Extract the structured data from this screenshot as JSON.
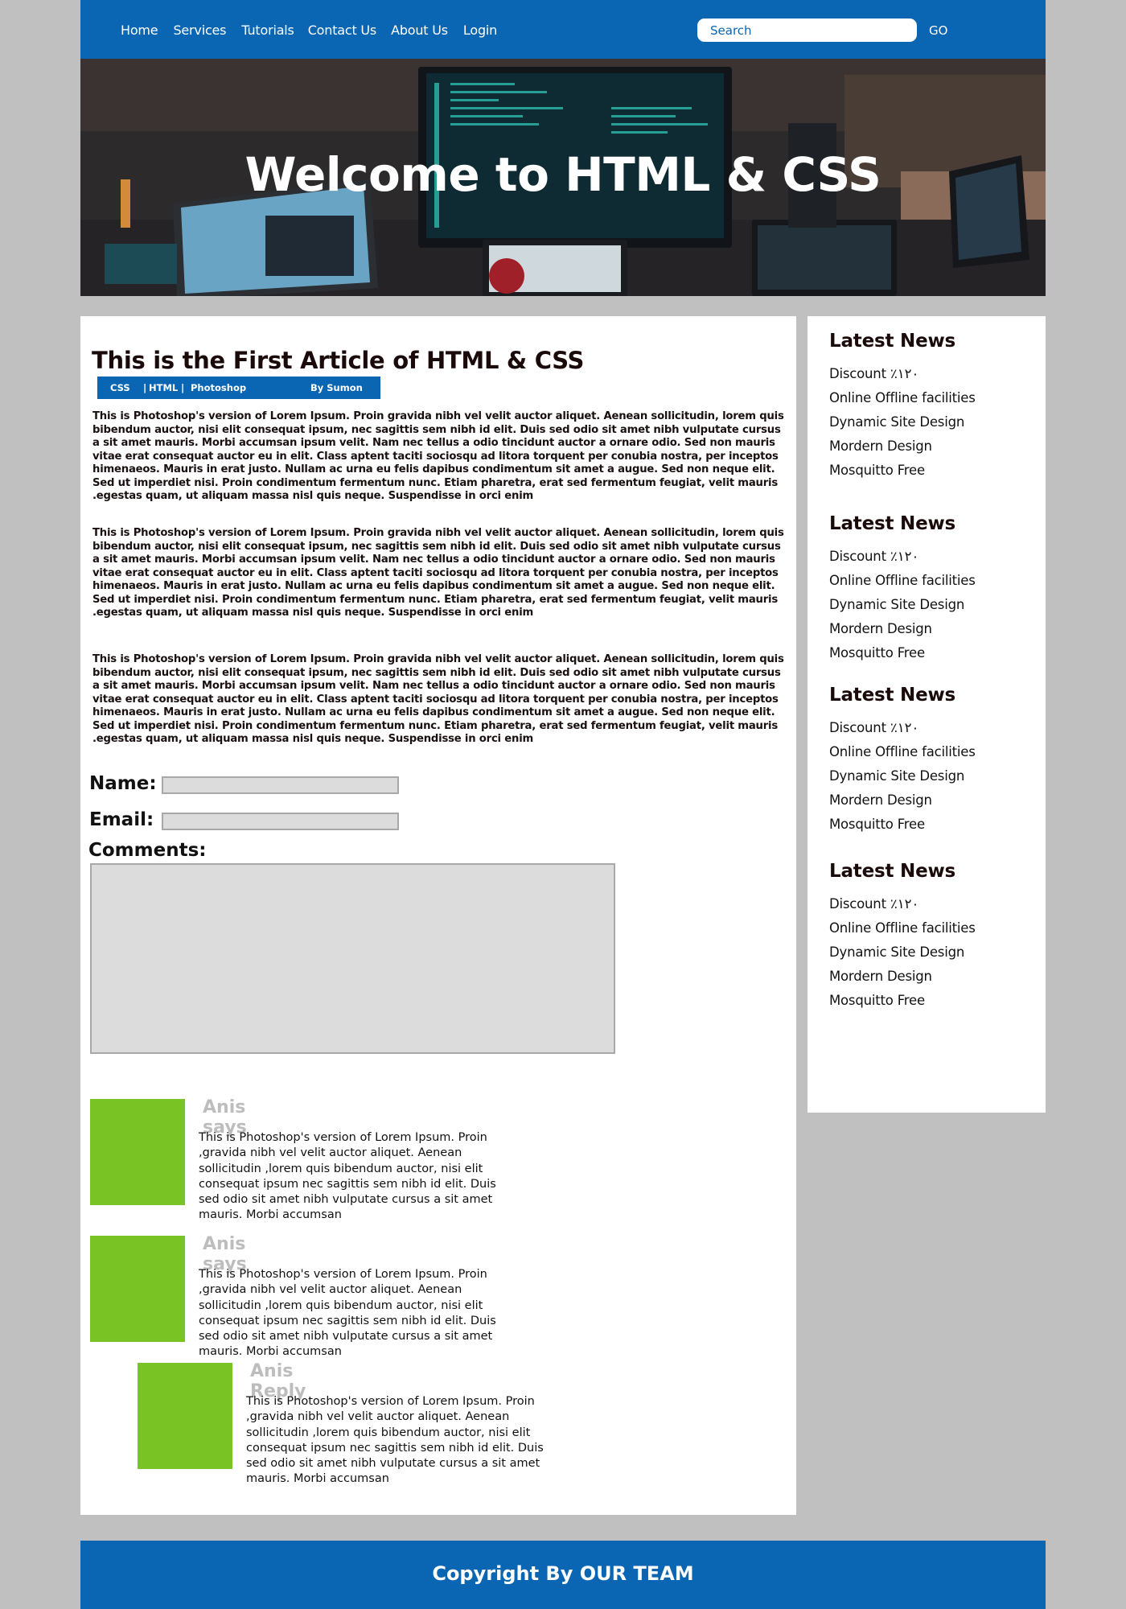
{
  "nav": {
    "links": [
      "Home",
      "Services",
      "Tutorials",
      "Contact Us",
      "About Us",
      "Login"
    ],
    "search_placeholder": "Search",
    "go_label": "GO"
  },
  "hero": {
    "title": "Welcome to HTML & CSS"
  },
  "article": {
    "title": "This is the First Article of HTML & CSS",
    "meta": {
      "tags": [
        "CSS",
        "HTML",
        "Photoshop"
      ],
      "tag_separator": "|",
      "author": "By Sumon"
    },
    "paragraphs": [
      "This is Photoshop's version  of Lorem Ipsum. Proin gravida nibh vel velit auctor aliquet. Aenean sollicitudin, lorem quis bibendum auctor, nisi elit consequat ipsum, nec sagittis sem nibh id elit. Duis sed odio sit amet nibh vulputate cursus a sit amet mauris. Morbi accumsan ipsum velit. Nam nec tellus a odio tincidunt auctor a ornare odio. Sed non  mauris vitae erat consequat auctor eu in elit. Class aptent taciti sociosqu ad litora torquent per conubia nostra, per inceptos himenaeos. Mauris in erat justo. Nullam ac urna eu felis dapibus condimentum sit amet a augue. Sed non neque elit. Sed ut imperdiet nisi. Proin condimentum fermentum nunc. Etiam pharetra, erat sed fermentum feugiat, velit mauris .egestas quam, ut aliquam massa nisl quis neque. Suspendisse in orci enim",
      "This is Photoshop's version  of Lorem Ipsum. Proin gravida nibh vel velit auctor aliquet. Aenean sollicitudin, lorem quis bibendum auctor, nisi elit consequat ipsum, nec sagittis sem nibh id elit. Duis sed odio sit amet nibh vulputate cursus a sit amet mauris. Morbi accumsan ipsum velit. Nam nec tellus a odio tincidunt auctor a ornare odio. Sed non  mauris vitae erat consequat auctor eu in elit. Class aptent taciti sociosqu ad litora torquent per conubia nostra, per inceptos himenaeos. Mauris in erat justo. Nullam ac urna eu felis dapibus condimentum sit amet a augue. Sed non neque elit. Sed ut imperdiet nisi. Proin condimentum fermentum nunc. Etiam pharetra, erat sed fermentum feugiat, velit mauris .egestas quam, ut aliquam massa nisl quis neque. Suspendisse in orci enim",
      "This is Photoshop's version  of Lorem Ipsum. Proin gravida nibh vel velit auctor aliquet. Aenean sollicitudin, lorem quis bibendum auctor, nisi elit consequat ipsum, nec sagittis sem nibh id elit. Duis sed odio sit amet nibh vulputate cursus a sit amet mauris. Morbi accumsan ipsum velit. Nam nec tellus a odio tincidunt auctor a ornare odio. Sed non  mauris vitae erat consequat auctor eu in elit. Class aptent taciti sociosqu ad litora torquent per conubia nostra, per inceptos himenaeos. Mauris in erat justo. Nullam ac urna eu felis dapibus condimentum sit amet a augue. Sed non neque elit. Sed ut imperdiet nisi. Proin condimentum fermentum nunc. Etiam pharetra, erat sed fermentum feugiat, velit mauris .egestas quam, ut aliquam massa nisl quis neque. Suspendisse in orci enim"
    ]
  },
  "form": {
    "name_label": "Name:",
    "email_label": "Email:",
    "comments_label": "Comments:"
  },
  "comments": [
    {
      "name": "Anis says",
      "text": "This is Photoshop's version  of Lorem Ipsum. Proin ,gravida nibh vel velit auctor aliquet. Aenean sollicitudin ,lorem quis bibendum auctor, nisi elit consequat ipsum nec sagittis sem nibh id elit. Duis sed odio sit amet nibh vulputate cursus a sit amet mauris. Morbi accumsan"
    },
    {
      "name": "Anis says",
      "text": "This is Photoshop's version  of Lorem Ipsum. Proin ,gravida nibh vel velit auctor aliquet. Aenean sollicitudin ,lorem quis bibendum auctor, nisi elit consequat ipsum nec sagittis sem nibh id elit. Duis sed odio sit amet nibh vulputate cursus a sit amet mauris. Morbi accumsan"
    },
    {
      "name": "Anis Reply",
      "text": "This is Photoshop's version  of Lorem Ipsum. Proin ,gravida nibh vel velit auctor aliquet. Aenean sollicitudin ,lorem quis bibendum auctor, nisi elit consequat ipsum nec sagittis sem nibh id elit. Duis sed odio sit amet nibh vulputate cursus a sit amet mauris. Morbi accumsan"
    }
  ],
  "sidebar": {
    "blocks": [
      {
        "title": "Latest News",
        "items": [
          "Discount ٪١٢٠",
          "Online Offline facilities",
          "Dynamic Site Design",
          "Mordern Design",
          "Mosquitto Free"
        ]
      },
      {
        "title": "Latest News",
        "items": [
          "Discount ٪١٢٠",
          "Online Offline facilities",
          "Dynamic Site Design",
          "Mordern Design",
          "Mosquitto Free"
        ]
      },
      {
        "title": "Latest News",
        "items": [
          "Discount ٪١٢٠",
          "Online Offline facilities",
          "Dynamic Site Design",
          "Mordern Design",
          "Mosquitto Free"
        ]
      },
      {
        "title": "Latest News",
        "items": [
          "Discount ٪١٢٠",
          "Online Offline facilities",
          "Dynamic Site Design",
          "Mordern Design",
          "Mosquitto Free"
        ]
      }
    ]
  },
  "footer": {
    "text": "Copyright By OUR TEAM"
  },
  "colors": {
    "brand_blue": "#0a66b2",
    "avatar_green": "#79c424",
    "background": "#c0c0c0"
  }
}
